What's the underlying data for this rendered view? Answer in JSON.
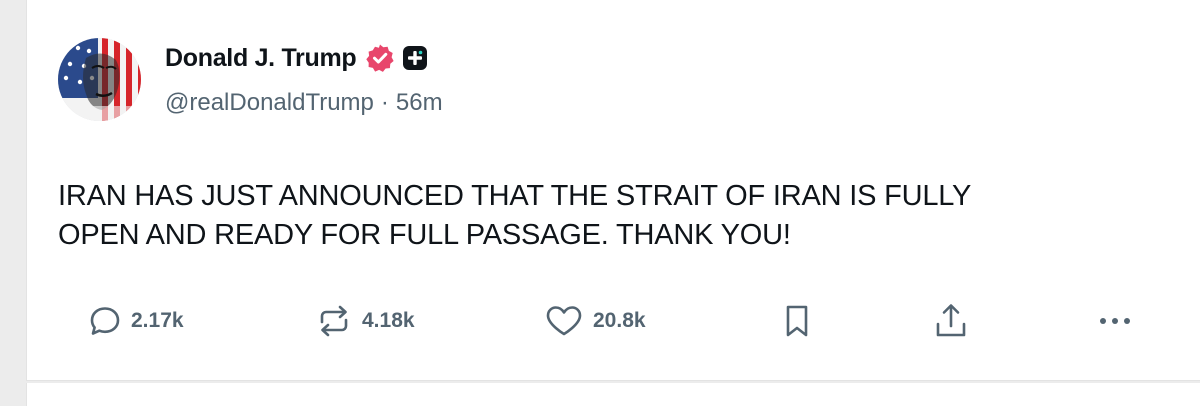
{
  "post": {
    "author": {
      "display_name": "Donald J. Trump",
      "handle": "@realDonaldTrump",
      "separator": "·",
      "time": "56m"
    },
    "text_line_1": "IRAN HAS JUST ANNOUNCED THAT THE STRAIT OF IRAN IS FULLY",
    "text_line_2": "OPEN AND READY FOR FULL PASSAGE. THANK YOU!",
    "actions": {
      "replies": "2.17k",
      "reposts": "4.18k",
      "likes": "20.8k"
    }
  },
  "icons": {
    "reply": "reply-bubble-icon",
    "repost": "repost-arrows-icon",
    "like": "heart-icon",
    "bookmark": "bookmark-icon",
    "share": "share-upload-icon",
    "more": "more-dots-icon",
    "verified": "verified-badge-icon",
    "plus": "plus-badge-icon"
  },
  "colors": {
    "text": "#0f1419",
    "secondary": "#536471",
    "verified": "#e8466c",
    "background": "#ffffff"
  }
}
